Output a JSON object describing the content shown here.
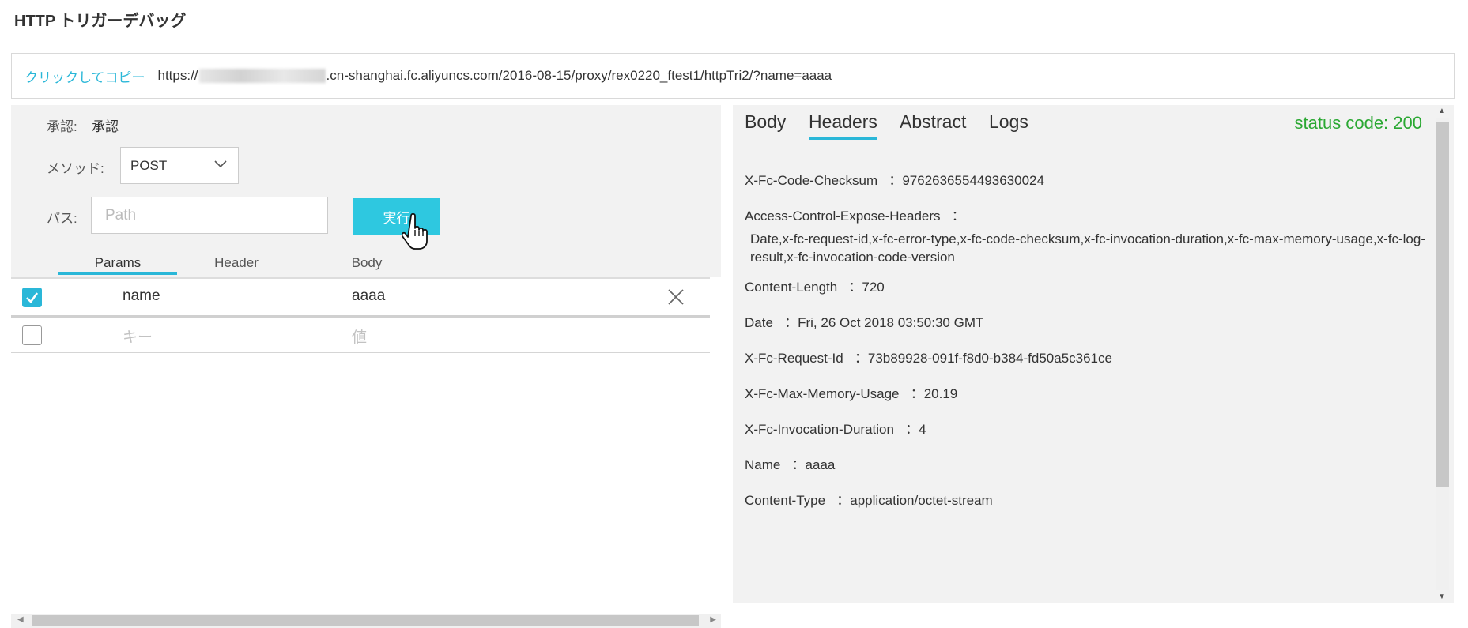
{
  "page": {
    "title": "HTTP トリガーデバッグ"
  },
  "url_bar": {
    "copy_label": "クリックしてコピー",
    "url_prefix": "https://",
    "url_suffix": ".cn-shanghai.fc.aliyuncs.com/2016-08-15/proxy/rex0220_ftest1/httpTri2/?name=aaaa"
  },
  "request": {
    "auth_label": "承認:",
    "auth_value": "承認",
    "method_label": "メソッド:",
    "method_value": "POST",
    "path_label": "パス:",
    "path_placeholder": "Path",
    "run_label": "実行",
    "tabs": [
      "Params",
      "Header",
      "Body"
    ],
    "params": [
      {
        "checked": true,
        "key": "name",
        "value": "aaaa"
      }
    ],
    "empty_row": {
      "key_placeholder": "キー",
      "value_placeholder": "値"
    }
  },
  "response": {
    "tabs": [
      "Body",
      "Headers",
      "Abstract",
      "Logs"
    ],
    "active_tab": "Headers",
    "status_text": "status code: 200",
    "headers": [
      {
        "name": "X-Fc-Code-Checksum",
        "value": "9762636554493630024"
      },
      {
        "name": "Access-Control-Expose-Headers",
        "value": "Date,x-fc-request-id,x-fc-error-type,x-fc-code-checksum,x-fc-invocation-duration,x-fc-max-memory-usage,x-fc-log-result,x-fc-invocation-code-version"
      },
      {
        "name": "Content-Length",
        "value": "720"
      },
      {
        "name": "Date",
        "value": "Fri, 26 Oct 2018 03:50:30 GMT"
      },
      {
        "name": "X-Fc-Request-Id",
        "value": "73b89928-091f-f8d0-b384-fd50a5c361ce"
      },
      {
        "name": "X-Fc-Max-Memory-Usage",
        "value": "20.19"
      },
      {
        "name": "X-Fc-Invocation-Duration",
        "value": "4"
      },
      {
        "name": "Name",
        "value": "aaaa"
      },
      {
        "name": "Content-Type",
        "value": "application/octet-stream"
      }
    ]
  },
  "colors": {
    "accent": "#2ab7d8",
    "run_button": "#2ec8e0",
    "status_ok": "#2aa832",
    "panel_bg": "#f2f2f2"
  }
}
